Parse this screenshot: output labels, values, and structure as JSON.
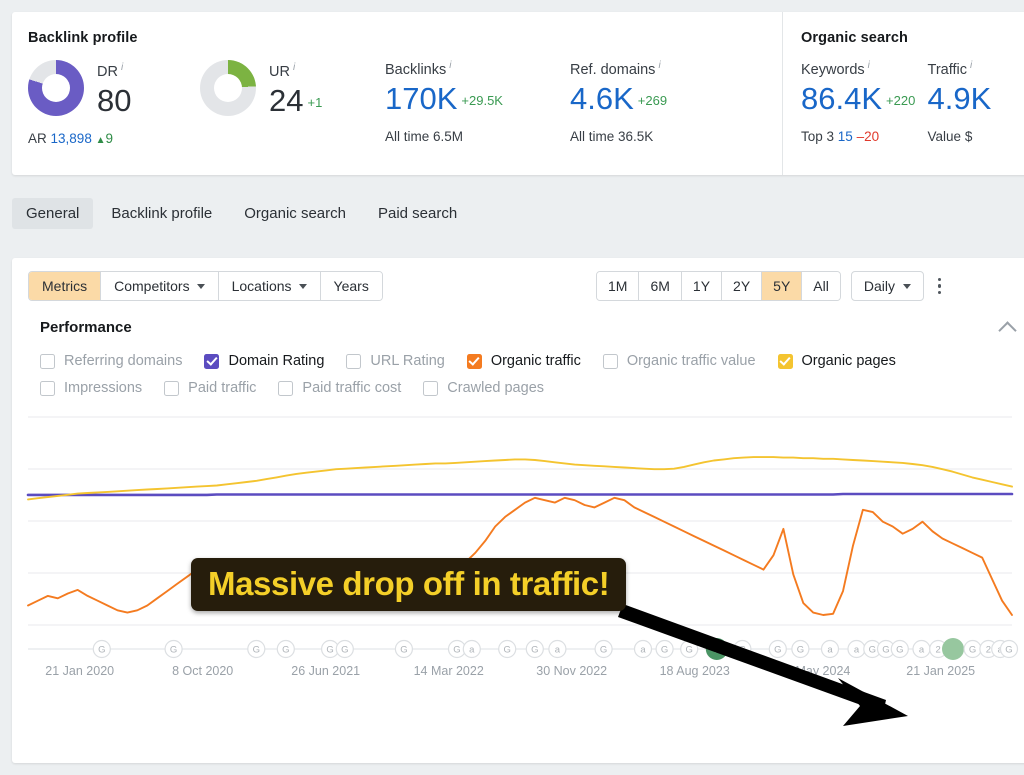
{
  "metrics": {
    "backlink_group_title": "Backlink profile",
    "organic_group_title": "Organic search",
    "dr": {
      "label": "DR",
      "info": "i",
      "value": "80",
      "donut_pct": 80,
      "donut_color": "#6a5cc4",
      "sub_label": "AR",
      "sub_value": "13,898",
      "sub_delta": "9",
      "sub_delta_dir": "up",
      "sub_tri": "▲"
    },
    "ur": {
      "label": "UR",
      "info": "i",
      "value": "24",
      "donut_pct": 24,
      "donut_color": "#7cb342",
      "delta": "+1",
      "delta_dir": "up"
    },
    "backlinks": {
      "label": "Backlinks",
      "info": "i",
      "value": "170K",
      "delta": "+29.5K",
      "delta_dir": "up",
      "sub_label": "All time",
      "sub_value": "6.5M"
    },
    "ref_domains": {
      "label": "Ref. domains",
      "info": "i",
      "value": "4.6K",
      "delta": "+269",
      "delta_dir": "up",
      "sub_label": "All time",
      "sub_value": "36.5K"
    },
    "keywords": {
      "label": "Keywords",
      "info": "i",
      "value": "86.4K",
      "delta": "+220",
      "delta_dir": "up",
      "sub_label": "Top 3",
      "sub_value": "15",
      "sub_delta": "–20",
      "sub_delta_dir": "down"
    },
    "traffic": {
      "label": "Traffic",
      "info": "i",
      "value": "4.9K",
      "sub_label": "Value",
      "sub_value": "$"
    }
  },
  "nav_tabs": [
    {
      "label": "General",
      "active": true
    },
    {
      "label": "Backlink profile",
      "active": false
    },
    {
      "label": "Organic search",
      "active": false
    },
    {
      "label": "Paid search",
      "active": false
    }
  ],
  "toolbar": {
    "left_buttons": [
      {
        "label": "Metrics",
        "selected": true,
        "caret": false
      },
      {
        "label": "Competitors",
        "selected": false,
        "caret": true
      },
      {
        "label": "Locations",
        "selected": false,
        "caret": true
      },
      {
        "label": "Years",
        "selected": false,
        "caret": false
      }
    ],
    "ranges": [
      {
        "label": "1M",
        "selected": false
      },
      {
        "label": "6M",
        "selected": false
      },
      {
        "label": "1Y",
        "selected": false
      },
      {
        "label": "2Y",
        "selected": false
      },
      {
        "label": "5Y",
        "selected": true
      },
      {
        "label": "All",
        "selected": false
      }
    ],
    "granularity": "Daily",
    "more_menu": "kebab-menu"
  },
  "performance": {
    "title": "Performance",
    "collapse_icon": "chevron-up-icon",
    "legend_row1": [
      {
        "label": "Referring domains",
        "checked": false,
        "color": "#6a5cc4"
      },
      {
        "label": "Domain Rating",
        "checked": true,
        "color": "#5b4cc0"
      },
      {
        "label": "URL Rating",
        "checked": false,
        "color": "#7cb342"
      },
      {
        "label": "Organic traffic",
        "checked": true,
        "color": "#f47b20"
      },
      {
        "label": "Organic traffic value",
        "checked": false,
        "color": "#2f8c47"
      },
      {
        "label": "Organic pages",
        "checked": true,
        "color": "#f4c430"
      }
    ],
    "legend_row2": [
      {
        "label": "Impressions",
        "checked": false,
        "color": "#888888"
      },
      {
        "label": "Paid traffic",
        "checked": false,
        "color": "#888888"
      },
      {
        "label": "Paid traffic cost",
        "checked": false,
        "color": "#888888"
      },
      {
        "label": "Crawled pages",
        "checked": false,
        "color": "#888888"
      }
    ]
  },
  "annotation": {
    "text": "Massive drop off in traffic!",
    "bg_color": "#261d0c",
    "text_color": "#f4cf28",
    "arrow_color": "#000000"
  },
  "chart_data": {
    "type": "line",
    "title": "Performance",
    "xlabel": "",
    "ylabel": "",
    "grid": true,
    "legend_position": "top",
    "axis_ticks": [
      "21 Jan 2020",
      "8 Oct 2020",
      "26 Jun 2021",
      "14 Mar 2022",
      "30 Nov 2022",
      "18 Aug 2023",
      "5 May 2024",
      "21 Jan 2025"
    ],
    "x_range": [
      "21 Jan 2020",
      "21 Jan 2025"
    ],
    "event_markers": [
      {
        "label": "G",
        "x": 0.075
      },
      {
        "label": "G",
        "x": 0.148
      },
      {
        "label": "G",
        "x": 0.232
      },
      {
        "label": "G",
        "x": 0.262
      },
      {
        "label": "G",
        "x": 0.307
      },
      {
        "label": "G",
        "x": 0.322
      },
      {
        "label": "G",
        "x": 0.382
      },
      {
        "label": "G",
        "x": 0.436
      },
      {
        "label": "a",
        "x": 0.451
      },
      {
        "label": "G",
        "x": 0.487
      },
      {
        "label": "G",
        "x": 0.515
      },
      {
        "label": "a",
        "x": 0.538
      },
      {
        "label": "G",
        "x": 0.585
      },
      {
        "label": "a",
        "x": 0.625
      },
      {
        "label": "G",
        "x": 0.647
      },
      {
        "label": "G",
        "x": 0.672
      },
      {
        "label": "G",
        "x": 0.7,
        "highlighted": true,
        "color": "#4a9464"
      },
      {
        "label": "G",
        "x": 0.726
      },
      {
        "label": "G",
        "x": 0.762
      },
      {
        "label": "G",
        "x": 0.785
      },
      {
        "label": "a",
        "x": 0.815
      },
      {
        "label": "a",
        "x": 0.842
      },
      {
        "label": "G",
        "x": 0.858
      },
      {
        "label": "G",
        "x": 0.872
      },
      {
        "label": "G",
        "x": 0.886
      },
      {
        "label": "a",
        "x": 0.908
      },
      {
        "label": "2",
        "x": 0.925
      },
      {
        "label": "",
        "x": 0.94,
        "highlighted": true,
        "color": "#97c79f"
      },
      {
        "label": "G",
        "x": 0.96
      },
      {
        "label": "2",
        "x": 0.976
      },
      {
        "label": "a",
        "x": 0.988
      },
      {
        "label": "G",
        "x": 0.997
      }
    ],
    "series": [
      {
        "name": "Domain Rating",
        "color": "#5b4cc0",
        "visible": true,
        "note": "flat near 78-80 across the whole 5Y window",
        "values": [
          78,
          78,
          78,
          78,
          78,
          78,
          78,
          78,
          78,
          78,
          78,
          78,
          78,
          78,
          78,
          78,
          78,
          78,
          78,
          79,
          79,
          79,
          79,
          79,
          79,
          79,
          79,
          79,
          79,
          79,
          79,
          79,
          79,
          79,
          79,
          79,
          79,
          79,
          79,
          79,
          79,
          79,
          79,
          79,
          79,
          79,
          79,
          79,
          79,
          79,
          79,
          79,
          79,
          79,
          79,
          79,
          79,
          79,
          79,
          79,
          79,
          79,
          79,
          79,
          79,
          79,
          79,
          79,
          79,
          79,
          79,
          79,
          79,
          79,
          79,
          79,
          79,
          79,
          79,
          79,
          79,
          79,
          80,
          80,
          80,
          80,
          80,
          80,
          80,
          80,
          80,
          80,
          80,
          80,
          80,
          80,
          80,
          80,
          80,
          80
        ]
      },
      {
        "name": "Organic pages",
        "color": "#f4c430",
        "visible": true,
        "note": "rises from low, peaks mid-window, declines at the end",
        "values": [
          60,
          62,
          64,
          66,
          68,
          70,
          71,
          72,
          73,
          74,
          75,
          76,
          77,
          78,
          79,
          80,
          81,
          82,
          83,
          84,
          86,
          88,
          90,
          92,
          95,
          98,
          101,
          104,
          106,
          108,
          110,
          112,
          113,
          114,
          115,
          116,
          117,
          118,
          119,
          120,
          121,
          122,
          122,
          123,
          124,
          125,
          126,
          127,
          128,
          129,
          129,
          128,
          126,
          124,
          122,
          120,
          119,
          118,
          117,
          116,
          115,
          114,
          113,
          112,
          112,
          113,
          116,
          120,
          124,
          127,
          129,
          131,
          132,
          133,
          133,
          133,
          132,
          132,
          131,
          131,
          130,
          130,
          129,
          128,
          127,
          126,
          125,
          124,
          123,
          121,
          119,
          116,
          112,
          108,
          103,
          98,
          94,
          90,
          86,
          82
        ]
      },
      {
        "name": "Organic traffic",
        "color": "#f47b20",
        "visible": true,
        "note": "volatile; climbs to peak mid-window then drops sharply at the end",
        "values": [
          18,
          22,
          26,
          24,
          28,
          31,
          26,
          22,
          18,
          14,
          12,
          14,
          18,
          24,
          30,
          36,
          42,
          48,
          52,
          55,
          56,
          54,
          52,
          50,
          48,
          44,
          46,
          50,
          48,
          44,
          40,
          38,
          36,
          34,
          32,
          30,
          34,
          38,
          36,
          34,
          36,
          40,
          44,
          48,
          54,
          62,
          72,
          84,
          92,
          98,
          104,
          108,
          106,
          104,
          108,
          106,
          102,
          100,
          104,
          108,
          106,
          100,
          96,
          92,
          88,
          84,
          80,
          76,
          72,
          68,
          64,
          60,
          56,
          52,
          48,
          60,
          82,
          44,
          20,
          12,
          10,
          11,
          30,
          68,
          98,
          96,
          88,
          84,
          78,
          82,
          88,
          80,
          74,
          70,
          66,
          62,
          58,
          40,
          22,
          10
        ]
      }
    ]
  }
}
